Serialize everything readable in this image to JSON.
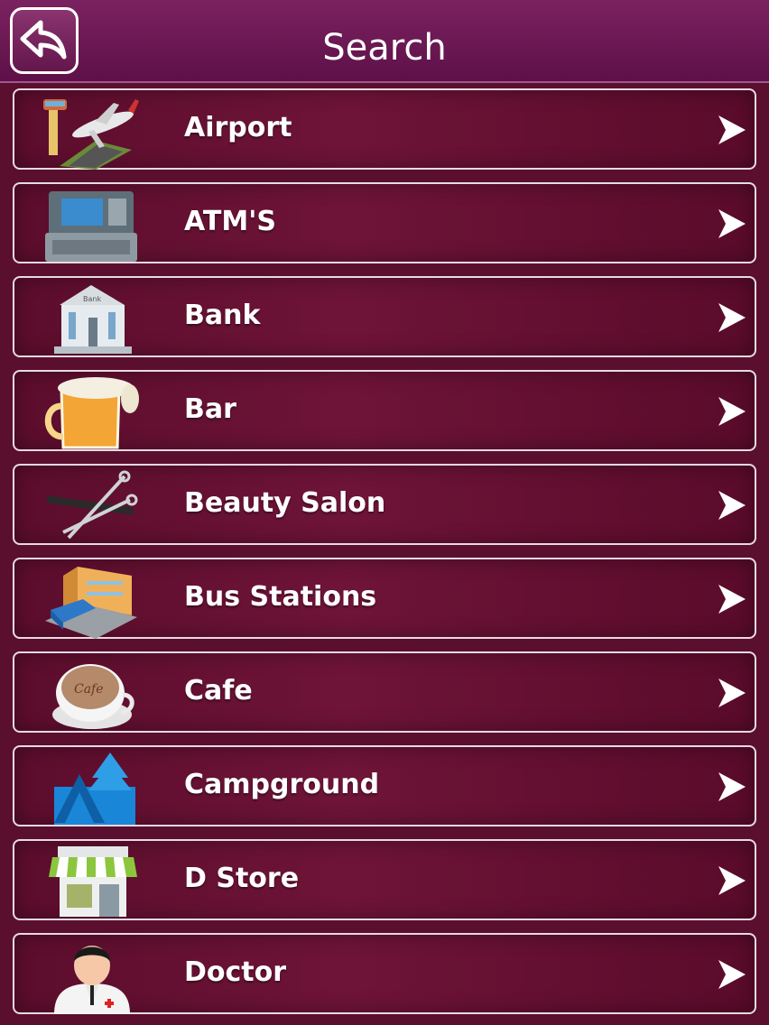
{
  "header": {
    "title": "Search",
    "back_icon": "back-arrow-icon"
  },
  "items": [
    {
      "label": "Airport",
      "icon": "airport-icon"
    },
    {
      "label": "ATM'S",
      "icon": "atm-icon"
    },
    {
      "label": "Bank",
      "icon": "bank-icon",
      "icon_text": "Bank"
    },
    {
      "label": "Bar",
      "icon": "beer-mug-icon"
    },
    {
      "label": "Beauty Salon",
      "icon": "scissors-comb-icon"
    },
    {
      "label": "Bus Stations",
      "icon": "bus-station-icon"
    },
    {
      "label": "Cafe",
      "icon": "coffee-cup-icon",
      "icon_text": "Cafe"
    },
    {
      "label": "Campground",
      "icon": "campground-icon"
    },
    {
      "label": "D Store",
      "icon": "store-icon"
    },
    {
      "label": "Doctor",
      "icon": "doctor-icon"
    }
  ]
}
